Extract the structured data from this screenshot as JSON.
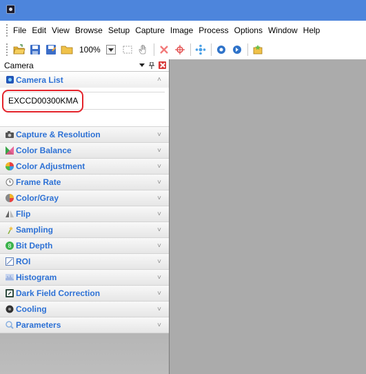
{
  "menu": {
    "items": [
      "File",
      "Edit",
      "View",
      "Browse",
      "Setup",
      "Capture",
      "Image",
      "Process",
      "Options",
      "Window",
      "Help"
    ]
  },
  "toolbar": {
    "zoom": "100%",
    "icons": [
      "open-folder-icon",
      "save-icon",
      "save-as-icon",
      "folder-icon",
      "zoom-dropdown-icon",
      "selection-rect-icon",
      "hand-pan-icon",
      "delete-x-icon",
      "crosshair-red-icon",
      "crosshair-blue-icon",
      "circle-left-icon",
      "circle-right-icon",
      "star-tool-icon"
    ]
  },
  "panel": {
    "title": "Camera",
    "camera_list": {
      "label": "Camera List",
      "selected": "EXCCD00300KMA"
    },
    "sections": [
      {
        "label": "Capture & Resolution",
        "icon": "camera-icon"
      },
      {
        "label": "Color Balance",
        "icon": "color-balance-icon"
      },
      {
        "label": "Color Adjustment",
        "icon": "color-wheel-icon"
      },
      {
        "label": "Frame Rate",
        "icon": "clock-icon"
      },
      {
        "label": "Color/Gray",
        "icon": "color-gray-icon"
      },
      {
        "label": "Flip",
        "icon": "flip-icon"
      },
      {
        "label": "Sampling",
        "icon": "sampling-icon"
      },
      {
        "label": "Bit Depth",
        "icon": "bit-depth-icon"
      },
      {
        "label": "ROI",
        "icon": "roi-icon"
      },
      {
        "label": "Histogram",
        "icon": "histogram-icon"
      },
      {
        "label": "Dark Field Correction",
        "icon": "dark-field-icon"
      },
      {
        "label": "Cooling",
        "icon": "cooling-icon"
      },
      {
        "label": "Parameters",
        "icon": "parameters-icon"
      }
    ]
  },
  "colors": {
    "titlebar": "#4d85dc",
    "section_label": "#2d71d5",
    "highlight": "#e4232b",
    "workspace": "#ababab"
  }
}
